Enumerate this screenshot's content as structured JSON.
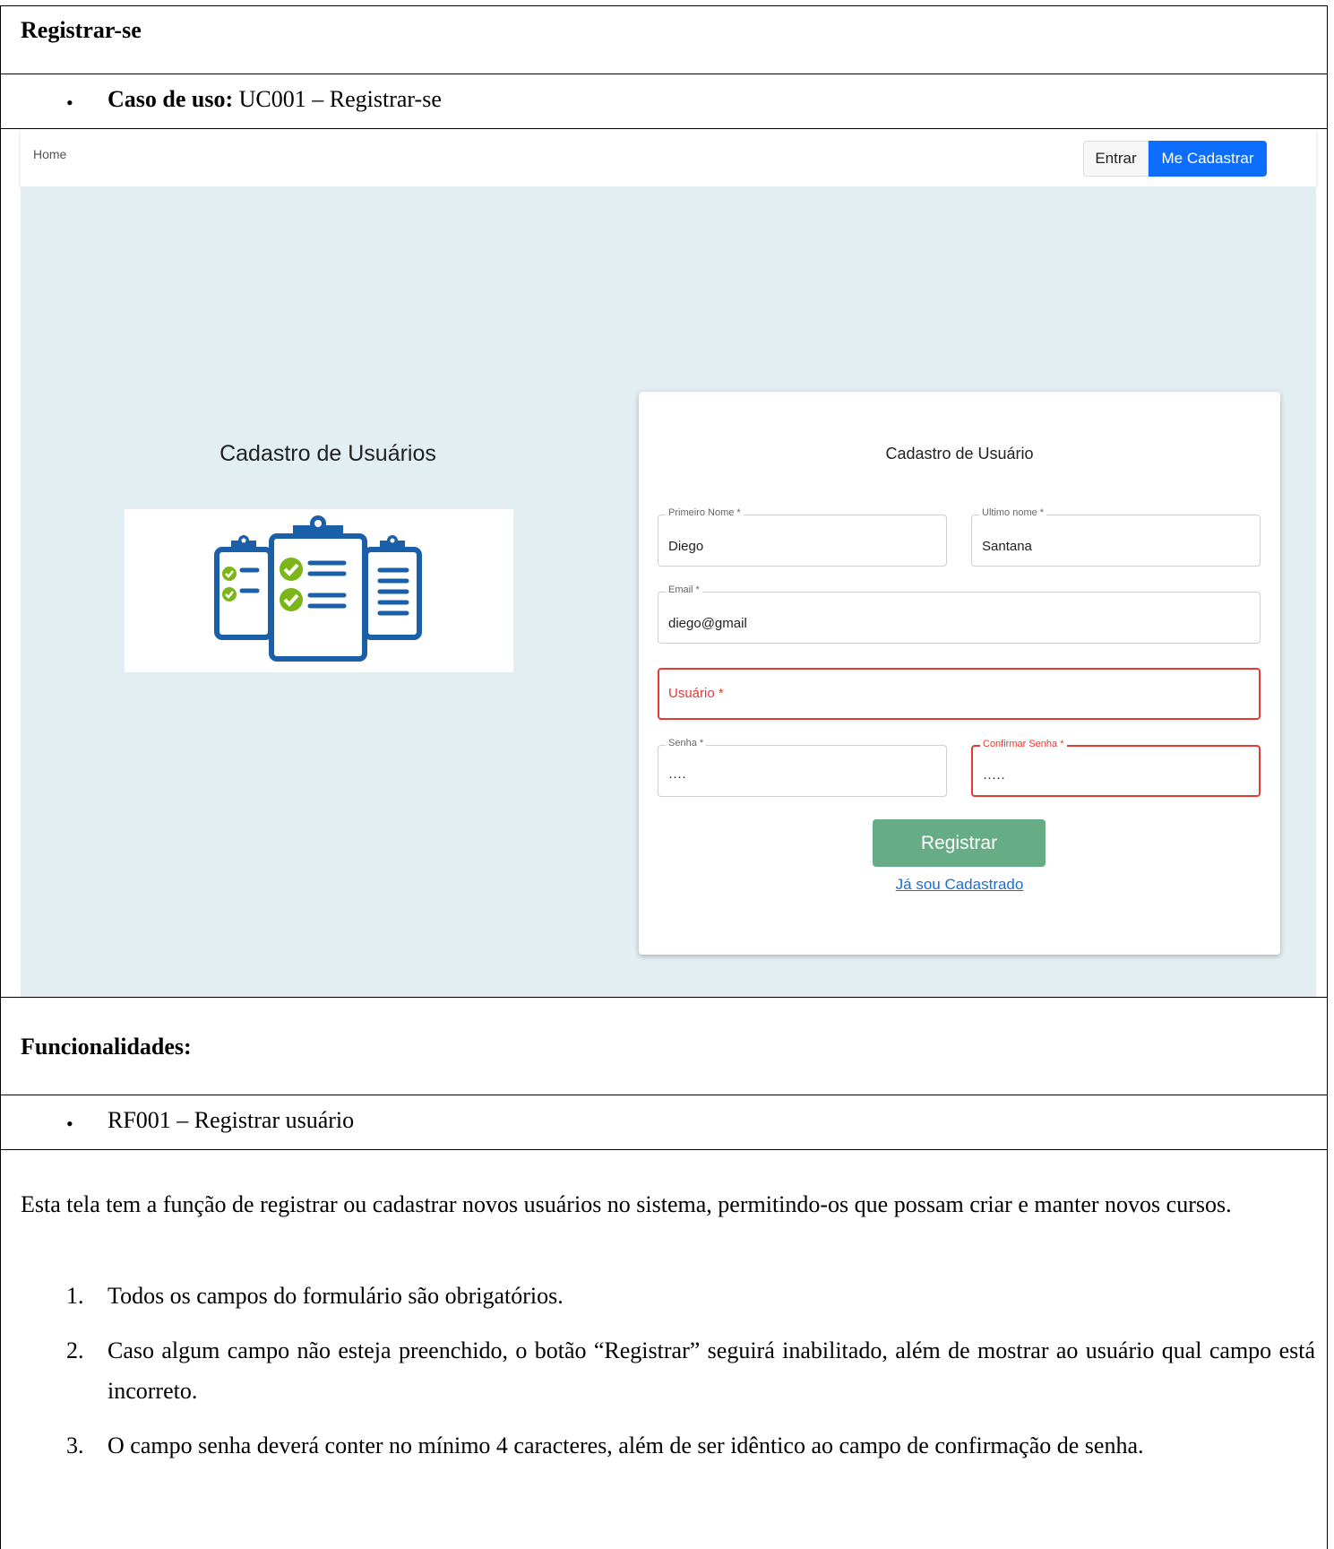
{
  "doc": {
    "title": "Registrar-se",
    "usecase_label": "Caso de uso:",
    "usecase_value": " UC001 – Registrar-se",
    "functionalities_title": "Funcionalidades:",
    "rf_item": "RF001 – Registrar usuário",
    "description": "Esta tela tem a função de registrar ou cadastrar novos usuários no sistema, permitindo-os que possam criar e manter novos cursos.",
    "requirements": [
      {
        "num": "1.",
        "text": "Todos os campos do formulário são obrigatórios."
      },
      {
        "num": "2.",
        "text": "Caso algum campo não esteja preenchido, o botão “Registrar” seguirá inabilitado, além de mostrar ao usuário qual campo está incorreto."
      },
      {
        "num": "3.",
        "text": "O campo senha deverá conter no mínimo 4 caracteres, além de ser idêntico ao campo de confirmação de senha."
      }
    ],
    "bullet": "•"
  },
  "app": {
    "nav": {
      "home": "Home",
      "login": "Entrar",
      "signup": "Me Cadastrar"
    },
    "left_title": "Cadastro de Usuários",
    "form": {
      "title": "Cadastro de Usuário",
      "first_name": {
        "label": "Primeiro Nome *",
        "value": "Diego"
      },
      "last_name": {
        "label": "Ultimo nome *",
        "value": "Santana"
      },
      "email": {
        "label": "Email *",
        "value": "diego@gmail"
      },
      "username": {
        "placeholder": "Usuário *"
      },
      "password": {
        "label": "Senha *",
        "value": "····"
      },
      "confirm_password": {
        "label": "Confirmar Senha *",
        "value": "·····"
      },
      "submit": "Registrar",
      "login_link": "Já sou Cadastrado"
    },
    "colors": {
      "primary": "#0d6efd",
      "submit": "#66ad86",
      "error": "#e53935",
      "background": "#e2eef2",
      "illustration": "#1a5fa8",
      "check": "#7cb518"
    },
    "illustration_icon": "clipboard-checklist-icon"
  }
}
